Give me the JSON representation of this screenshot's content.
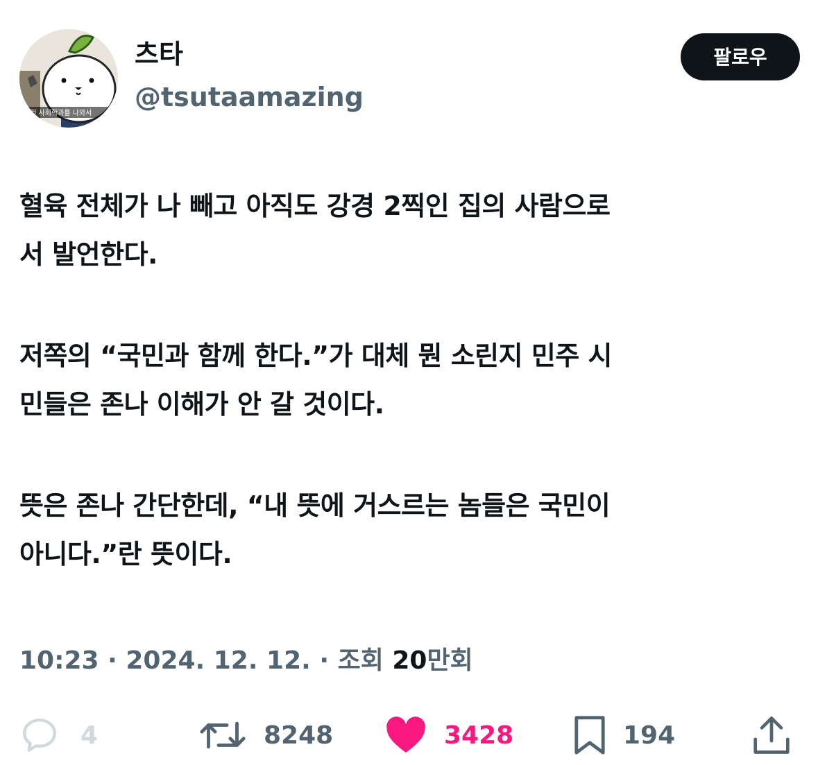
{
  "user": {
    "display_name": "츠타",
    "handle": "@tsutaamazing",
    "avatar_caption": "요건 사회학과를 나와서"
  },
  "follow_button": "팔로우",
  "tweet": {
    "paragraphs": [
      [
        "혈육 전체가 나 빼고 아직도 강경 2찍인 집의 사람으로",
        "서 발언한다."
      ],
      [
        "저쪽의 “국민과 함께 한다.”가 대체 뭔 소린지 민주 시",
        "민들은 존나 이해가 안 갈 것이다."
      ],
      [
        "뜻은 존나 간단한데, “내 뜻에 거스르는 놈들은 국민이",
        "아니다.”란 뜻이다."
      ]
    ]
  },
  "meta": {
    "time": "10:23",
    "separator": " · ",
    "date": "2024. 12. 12.",
    "views_label": "조회 ",
    "views_count": "20",
    "views_suffix": "만회"
  },
  "actions": {
    "reply": {
      "icon": "reply-icon",
      "count": "4"
    },
    "retweet": {
      "icon": "retweet-icon",
      "count": "8248"
    },
    "like": {
      "icon": "heart-icon",
      "count": "3428",
      "color": "#f91880"
    },
    "bookmark": {
      "icon": "bookmark-icon",
      "count": "194"
    },
    "share": {
      "icon": "share-icon"
    }
  }
}
